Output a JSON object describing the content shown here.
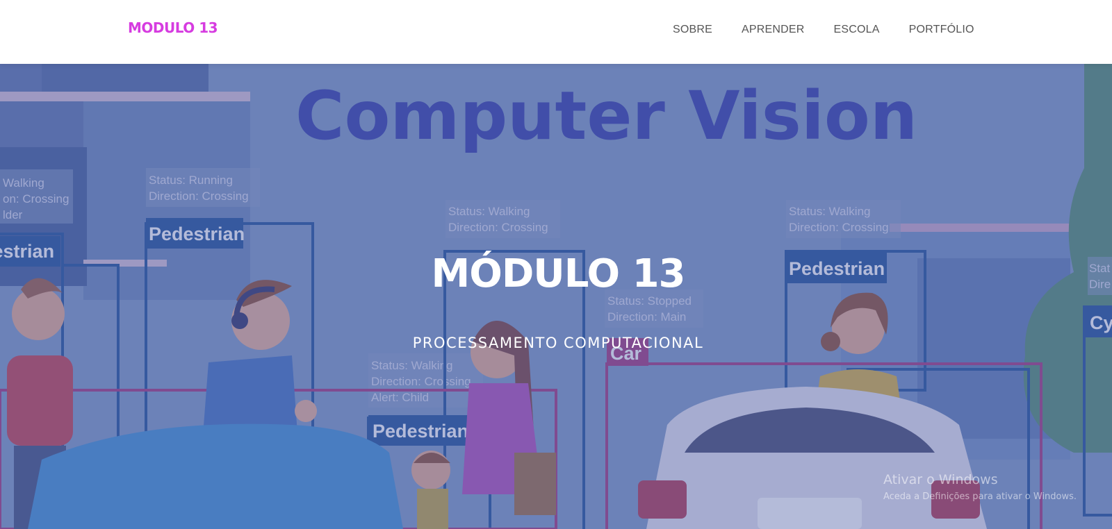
{
  "nav": {
    "brand": "MODULO 13",
    "links": [
      "SOBRE",
      "APRENDER",
      "ESCOLA",
      "PORTFÓLIO"
    ]
  },
  "hero": {
    "title": "MÓDULO 13",
    "subtitle": "PROCESSAMENTO COMPUTACIONAL",
    "background_image": {
      "heading": "Computer Vision",
      "labels": {
        "pedestrian": "Pedestrian",
        "car": "Car",
        "cyclist": "Cy"
      },
      "status_boxes": [
        [
          "Walking",
          "on: Crossing",
          "lder"
        ],
        [
          "Status: Running",
          "Direction: Crossing"
        ],
        [
          "Status: Walking",
          "Direction: Crossing"
        ],
        [
          "Status: Walking",
          "Direction: Crossing"
        ],
        [
          "Status: Stopped",
          "Direction: Main"
        ],
        [
          "Status: Walking",
          "Direction: Crossing",
          "Alert: Child"
        ],
        [
          "Stat",
          "Dire"
        ]
      ]
    }
  },
  "watermark": {
    "line1": "Ativar o Windows",
    "line2": "Aceda a Definições para ativar o Windows."
  },
  "colors": {
    "brand": "#d63ce0",
    "nav_text": "#555555",
    "hero_overlay": "#5869aa",
    "box_blue": "#1b4e96",
    "box_magenta": "#a0337a"
  }
}
